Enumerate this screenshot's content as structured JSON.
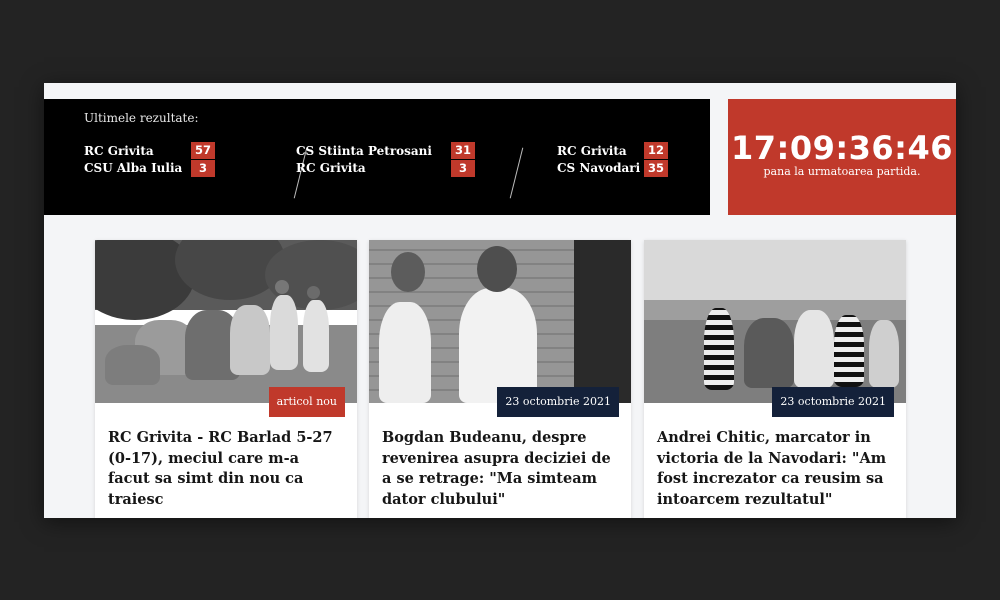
{
  "results": {
    "title": "Ultimele rezultate:",
    "matches": [
      {
        "home": "RC Grivita",
        "home_score": "57",
        "away": "CSU Alba Iulia",
        "away_score": "3"
      },
      {
        "home": "CS Stiinta Petrosani",
        "home_score": "31",
        "away": "RC Grivita",
        "away_score": "3"
      },
      {
        "home": "RC Grivita",
        "home_score": "12",
        "away": "CS Navodari",
        "away_score": "35"
      }
    ]
  },
  "countdown": {
    "time": "17:09:36:46",
    "caption": "pana la urmatoarea partida."
  },
  "articles": [
    {
      "badge": "articol nou",
      "badge_color": "#c0392b",
      "headline": "RC Grivita - RC Barlad 5-27 (0-17), meciul care m-a facut sa simt din nou ca traiesc"
    },
    {
      "badge": "23 octombrie 2021",
      "badge_color": "#14213a",
      "headline": "Bogdan Budeanu, despre revenirea asupra deciziei de a se retrage: \"Ma simteam dator clubului\""
    },
    {
      "badge": "23 octombrie 2021",
      "badge_color": "#14213a",
      "headline": "Andrei Chitic, marcator in victoria de la Navodari: \"Am fost increzator ca reusim sa intoarcem rezultatul\""
    }
  ],
  "colors": {
    "accent": "#c0392b",
    "navy": "#14213a",
    "background": "#232323"
  }
}
